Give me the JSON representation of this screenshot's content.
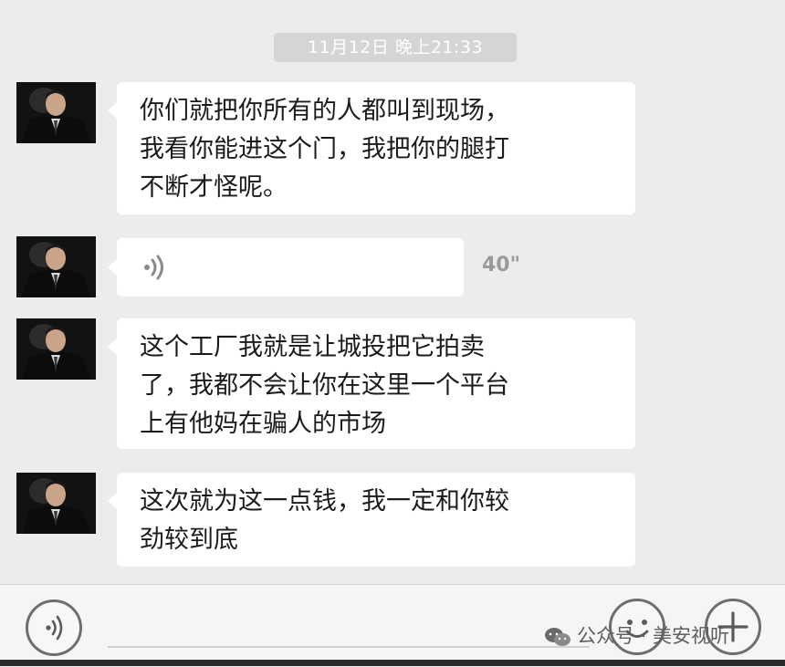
{
  "chat": {
    "timestamp": "11月12日 晚上21:33",
    "messages": [
      {
        "type": "text",
        "lines": [
          "你们就把你所有的人都叫到现场，",
          "我看你能进这个门，我把你的腿打",
          "不断才怪呢。"
        ]
      },
      {
        "type": "voice",
        "duration": "40\""
      },
      {
        "type": "text",
        "lines": [
          "这个工厂我就是让城投把它拍卖",
          "了，我都不会让你在这里一个平台",
          "上有他妈在骗人的市场"
        ]
      },
      {
        "type": "text",
        "lines": [
          "这次就为这一点钱，我一定和你较",
          "劲较到底"
        ]
      }
    ]
  },
  "input_bar": {
    "voice_toggle_icon": "voice-icon",
    "emoji_icon": "emoji-icon",
    "plus_icon": "plus-icon"
  },
  "watermark": {
    "text": "公众号 · 美安视听"
  },
  "colors": {
    "background": "#ececec",
    "bubble": "#ffffff",
    "timestamp_bg": "#d5d5d5"
  }
}
